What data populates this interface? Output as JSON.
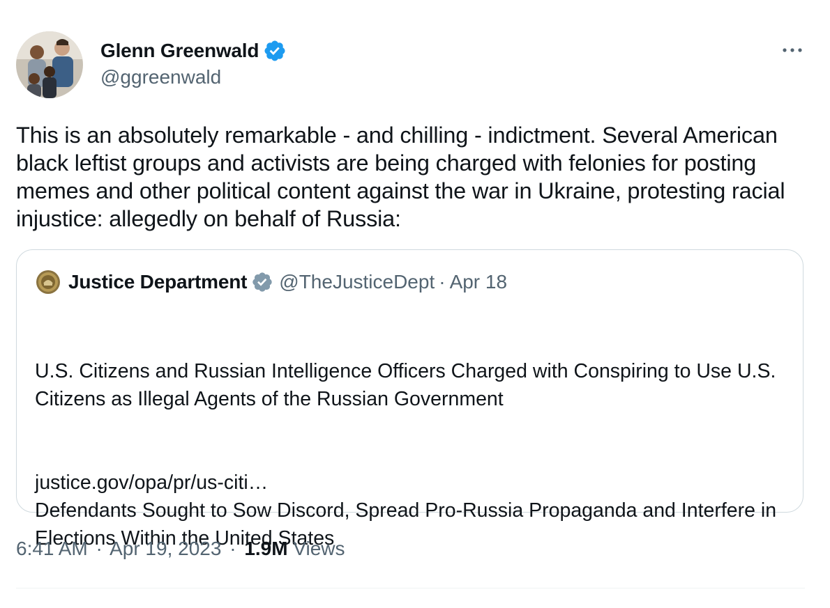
{
  "author": {
    "name": "Glenn Greenwald",
    "handle": "@ggreenwald",
    "verified_icon": "verified-badge-icon",
    "verified_color": "#1d9bf0"
  },
  "more_icon": "more-options-icon",
  "tweet_text": "This is an absolutely remarkable - and chilling - indictment. Several American black leftist groups and activists are being charged with felonies for posting memes and other political content against the war in Ukraine, protesting racial injustice: allegedly on behalf of Russia:",
  "quoted_tweet": {
    "name": "Justice Department",
    "handle": "@TheJusticeDept",
    "separator": "·",
    "date": "Apr 18",
    "verified_icon": "government-verified-badge-icon",
    "verified_color": "#829aab",
    "paragraph_1": "U.S. Citizens and Russian Intelligence Officers Charged with Conspiring to Use U.S. Citizens as Illegal Agents of the Russian Government",
    "paragraph_2": "Defendants Sought to Sow Discord, Spread Pro-Russia Propaganda and Interfere in Elections Within the United States",
    "link": "justice.gov/opa/pr/us-citi…"
  },
  "footer": {
    "time": "6:41 AM",
    "separator": "·",
    "date": "Apr 19, 2023",
    "views_count": "1.9M",
    "views_label": "Views"
  },
  "colors": {
    "text_primary": "#0f1419",
    "text_secondary": "#536471",
    "border": "#cfd9de"
  }
}
